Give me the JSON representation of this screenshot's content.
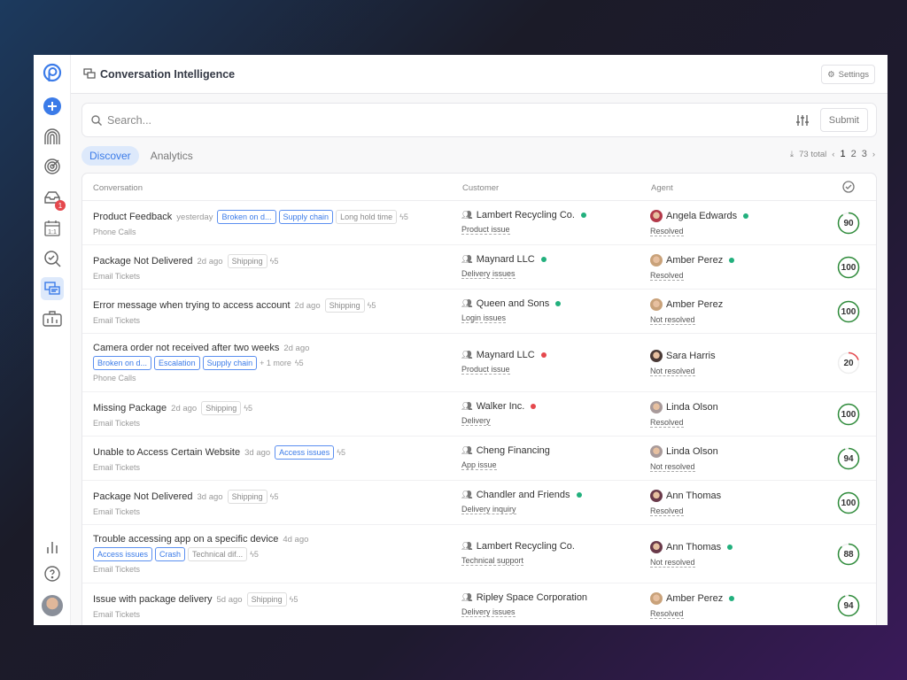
{
  "header": {
    "title": "Conversation Intelligence",
    "settings_label": "Settings"
  },
  "sidebar": {
    "inbox_badge": "1",
    "calendar_label": "1:1"
  },
  "search": {
    "placeholder": "Search...",
    "submit_label": "Submit"
  },
  "tabs": [
    {
      "label": "Discover",
      "active": true
    },
    {
      "label": "Analytics",
      "active": false
    }
  ],
  "pager": {
    "total": "73 total",
    "pages": [
      "1",
      "2",
      "3"
    ],
    "current": "1"
  },
  "columns": {
    "conversation": "Conversation",
    "customer": "Customer",
    "agent": "Agent"
  },
  "colors": {
    "accent": "#3b7be8",
    "good": "#2e8b3a",
    "bad": "#e5484d",
    "online": "#22b07d"
  },
  "rows": [
    {
      "title": "Product Feedback",
      "ago": "yesterday",
      "tags": [
        {
          "t": "Broken on d...",
          "b": true
        },
        {
          "t": "Supply chain",
          "b": true
        },
        {
          "t": "Long hold time",
          "b": false
        }
      ],
      "more": "",
      "zap": "5",
      "source": "Phone Calls",
      "wrap": false,
      "customer": "Lambert Recycling Co.",
      "cdot": "green",
      "issue": "Product issue",
      "agent": "Angela Edwards",
      "adot": "green",
      "status": "Resolved",
      "score": 90,
      "avc": "#b33a4a"
    },
    {
      "title": "Package Not Delivered",
      "ago": "2d ago",
      "tags": [
        {
          "t": "Shipping",
          "b": false
        }
      ],
      "more": "",
      "zap": "5",
      "source": "Email Tickets",
      "wrap": false,
      "customer": "Maynard LLC",
      "cdot": "green",
      "issue": "Delivery issues",
      "agent": "Amber Perez",
      "adot": "green",
      "status": "Resolved",
      "score": 100,
      "avc": "#c9a27a"
    },
    {
      "title": "Error message when trying to access account",
      "ago": "2d ago",
      "tags": [
        {
          "t": "Shipping",
          "b": false
        }
      ],
      "more": "",
      "zap": "5",
      "source": "Email Tickets",
      "wrap": false,
      "customer": "Queen and Sons",
      "cdot": "green",
      "issue": "Login issues",
      "agent": "Amber Perez",
      "adot": "",
      "status": "Not resolved",
      "score": 100,
      "avc": "#c9a27a"
    },
    {
      "title": "Camera order not received after two weeks",
      "ago": "2d ago",
      "tags": [
        {
          "t": "Broken on d...",
          "b": true
        },
        {
          "t": "Escalation",
          "b": true
        },
        {
          "t": "Supply chain",
          "b": true
        }
      ],
      "more": "+ 1 more",
      "zap": "5",
      "source": "Phone Calls",
      "wrap": true,
      "customer": "Maynard LLC",
      "cdot": "red",
      "issue": "Product issue",
      "agent": "Sara Harris",
      "adot": "",
      "status": "Not resolved",
      "score": 20,
      "avc": "#4a3a36"
    },
    {
      "title": "Missing Package",
      "ago": "2d ago",
      "tags": [
        {
          "t": "Shipping",
          "b": false
        }
      ],
      "more": "",
      "zap": "5",
      "source": "Email Tickets",
      "wrap": false,
      "customer": "Walker Inc.",
      "cdot": "red",
      "issue": "Delivery",
      "agent": "Linda Olson",
      "adot": "",
      "status": "Resolved",
      "score": 100,
      "avc": "#a89a9a"
    },
    {
      "title": "Unable to Access Certain Website",
      "ago": "3d ago",
      "tags": [
        {
          "t": "Access issues",
          "b": true
        }
      ],
      "more": "",
      "zap": "5",
      "source": "Email Tickets",
      "wrap": false,
      "customer": "Cheng Financing",
      "cdot": "",
      "issue": "App issue",
      "agent": "Linda Olson",
      "adot": "",
      "status": "Not resolved",
      "score": 94,
      "avc": "#a89a9a"
    },
    {
      "title": "Package Not Delivered",
      "ago": "3d ago",
      "tags": [
        {
          "t": "Shipping",
          "b": false
        }
      ],
      "more": "",
      "zap": "5",
      "source": "Email Tickets",
      "wrap": false,
      "customer": "Chandler and Friends",
      "cdot": "green",
      "issue": "Delivery inquiry",
      "agent": "Ann Thomas",
      "adot": "",
      "status": "Resolved",
      "score": 100,
      "avc": "#6a3a4a"
    },
    {
      "title": "Trouble accessing app on a specific device",
      "ago": "4d ago",
      "tags": [
        {
          "t": "Access issues",
          "b": true
        },
        {
          "t": "Crash",
          "b": true
        },
        {
          "t": "Technical dif...",
          "b": false
        }
      ],
      "more": "",
      "zap": "5",
      "source": "Email Tickets",
      "wrap": true,
      "customer": "Lambert Recycling Co.",
      "cdot": "",
      "issue": "Technical support",
      "agent": "Ann Thomas",
      "adot": "green",
      "status": "Not resolved",
      "score": 88,
      "avc": "#6a3a4a"
    },
    {
      "title": "Issue with package delivery",
      "ago": "5d ago",
      "tags": [
        {
          "t": "Shipping",
          "b": false
        }
      ],
      "more": "",
      "zap": "5",
      "source": "Email Tickets",
      "wrap": false,
      "customer": "Ripley Space Corporation",
      "cdot": "",
      "issue": "Delivery issues",
      "agent": "Amber Perez",
      "adot": "green",
      "status": "Resolved",
      "score": 94,
      "avc": "#c9a27a"
    }
  ]
}
